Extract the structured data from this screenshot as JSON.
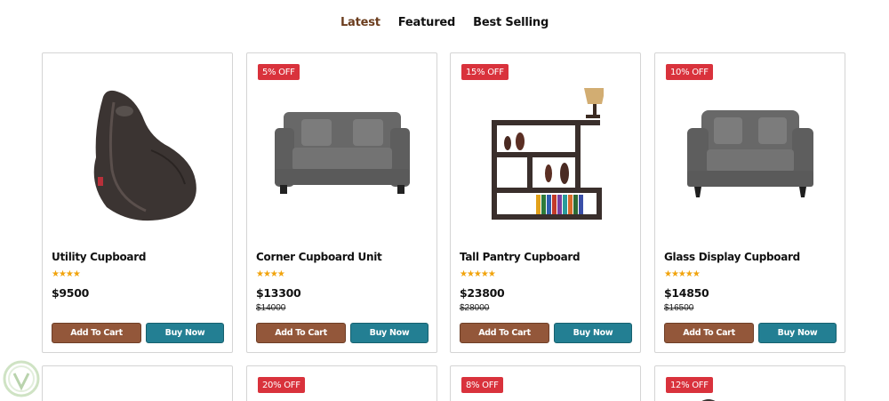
{
  "tabs": [
    {
      "label": "Latest",
      "active": true
    },
    {
      "label": "Featured",
      "active": false
    },
    {
      "label": "Best Selling",
      "active": false
    }
  ],
  "products": [
    {
      "name": "Utility Cupboard",
      "stars": "★★★★",
      "price": "$9500",
      "old_price": "",
      "badge": "",
      "image_icon": "bean-bag-icon"
    },
    {
      "name": "Corner Cupboard Unit",
      "stars": "★★★★",
      "price": "$13300",
      "old_price": "$14000",
      "badge": "5% OFF",
      "image_icon": "sofa-icon"
    },
    {
      "name": "Tall Pantry Cupboard",
      "stars": "★★★★★",
      "price": "$23800",
      "old_price": "$28000",
      "badge": "15% OFF",
      "image_icon": "shelf-icon"
    },
    {
      "name": "Glass Display Cupboard",
      "stars": "★★★★★",
      "price": "$14850",
      "old_price": "$16500",
      "badge": "10% OFF",
      "image_icon": "armchair-sofa-icon"
    }
  ],
  "row2_badges": [
    "",
    "20% OFF",
    "8% OFF",
    "12% OFF"
  ],
  "buttons": {
    "add_to_cart": "Add To Cart",
    "buy_now": "Buy Now"
  },
  "colors": {
    "badge": "#d9323c",
    "add_to_cart": "#93573a",
    "buy_now": "#237f93",
    "stars": "#f1a30c",
    "active_tab": "#6b3d1e"
  }
}
